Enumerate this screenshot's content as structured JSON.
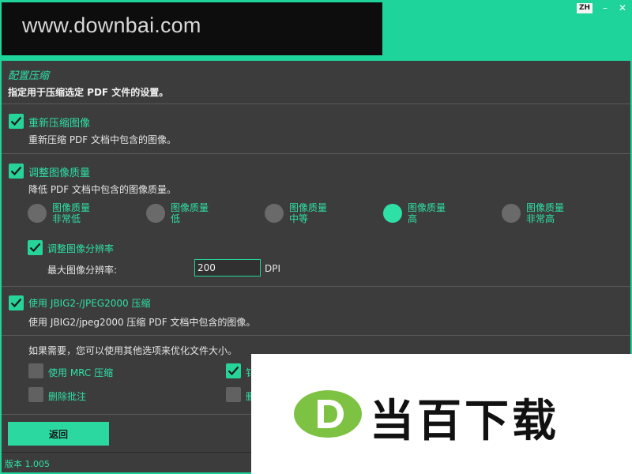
{
  "header": {
    "banner_text": "www.downbai.com",
    "lang_badge": "ZH",
    "minimize_glyph": "–",
    "close_glyph": "✕"
  },
  "intro": {
    "title": "配置压缩",
    "description": "指定用于压缩选定 PDF 文件的设置。"
  },
  "options": {
    "recompress": {
      "label": "重新压缩图像",
      "description": "重新压缩 PDF 文档中包含的图像。",
      "checked": true
    },
    "quality": {
      "label": "调整图像质量",
      "description": "降低 PDF 文档中包含的图像质量。",
      "checked": true,
      "levels": [
        {
          "line1": "图像质量",
          "line2": "非常低",
          "selected": false
        },
        {
          "line1": "图像质量",
          "line2": "低",
          "selected": false
        },
        {
          "line1": "图像质量",
          "line2": "中等",
          "selected": false
        },
        {
          "line1": "图像质量",
          "line2": "高",
          "selected": true
        },
        {
          "line1": "图像质量",
          "line2": "非常高",
          "selected": false
        }
      ]
    },
    "resolution": {
      "label": "调整图像分辨率",
      "checked": true,
      "field_label": "最大图像分辨率:",
      "value": "200",
      "unit": "DPI"
    },
    "jbig2": {
      "label": "使用 JBIG2-/JPEG2000 压缩",
      "description": "使用 JBIG2/jpeg2000 压缩 PDF 文档中包含的图像。",
      "checked": true
    }
  },
  "extra": {
    "intro": "如果需要，您可以使用其他选项来优化文件大小。",
    "mrc": {
      "label": "使用 MRC 压缩",
      "checked": false
    },
    "partial_right_top": {
      "label": "钅",
      "checked": true
    },
    "remove_annotations": {
      "label": "删除批注",
      "checked": false
    },
    "partial_right_bottom": {
      "label": "删",
      "checked": false
    }
  },
  "buttons": {
    "back": "返回"
  },
  "footer": {
    "version": "版本 1.005"
  },
  "watermark": {
    "text": "当百下载",
    "logo_letter": "D"
  },
  "colors": {
    "accent": "#2ee0a6",
    "panel": "#3c3c3c",
    "frame": "#1ed49a"
  },
  "icons": {
    "checkbox_checked": "check-icon",
    "close": "close-icon",
    "minimize": "minimize-icon"
  }
}
